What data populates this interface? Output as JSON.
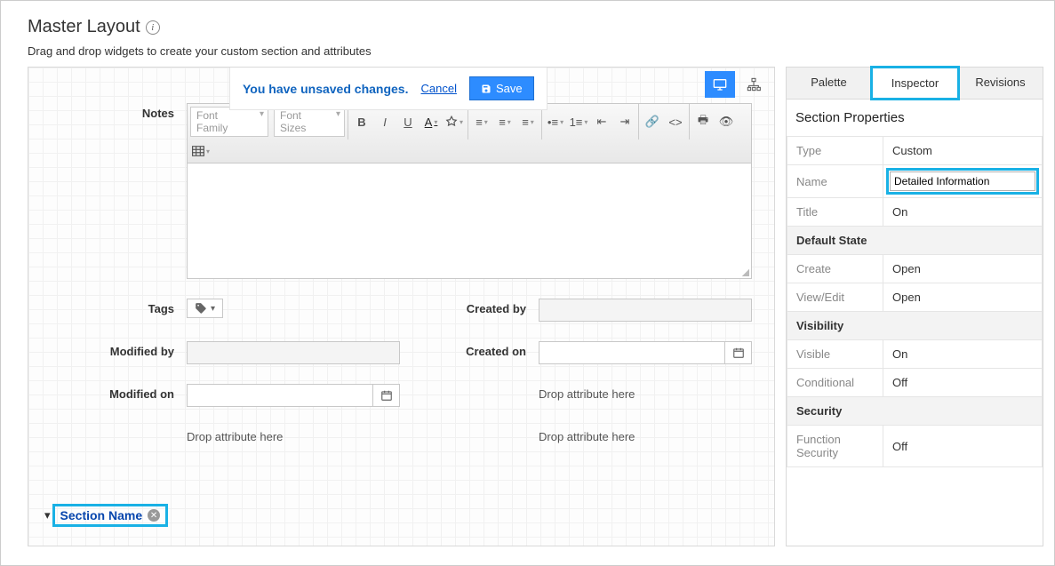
{
  "header": {
    "title": "Master Layout",
    "subtitle": "Drag and drop widgets to create your custom section and attributes"
  },
  "unsaved": {
    "message": "You have unsaved changes.",
    "cancel": "Cancel",
    "save": "Save"
  },
  "editor": {
    "font_family_placeholder": "Font Family",
    "font_sizes_placeholder": "Font Sizes"
  },
  "fields": {
    "notes": "Notes",
    "tags": "Tags",
    "created_by": "Created by",
    "modified_by": "Modified by",
    "created_on": "Created on",
    "modified_on": "Modified on",
    "drop_hint": "Drop attribute here"
  },
  "section": {
    "name_label": "Section Name"
  },
  "sidebar": {
    "tabs": {
      "palette": "Palette",
      "inspector": "Inspector",
      "revisions": "Revisions"
    },
    "active_tab": "inspector",
    "section_properties_title": "Section Properties",
    "props": {
      "type_k": "Type",
      "type_v": "Custom",
      "name_k": "Name",
      "name_v": "Detailed Information",
      "title_k": "Title",
      "title_v": "On"
    },
    "default_state_title": "Default State",
    "default_state": {
      "create_k": "Create",
      "create_v": "Open",
      "viewedit_k": "View/Edit",
      "viewedit_v": "Open"
    },
    "visibility_title": "Visibility",
    "visibility": {
      "visible_k": "Visible",
      "visible_v": "On",
      "conditional_k": "Conditional",
      "conditional_v": "Off"
    },
    "security_title": "Security",
    "security": {
      "func_k": "Function Security",
      "func_v": "Off"
    }
  }
}
